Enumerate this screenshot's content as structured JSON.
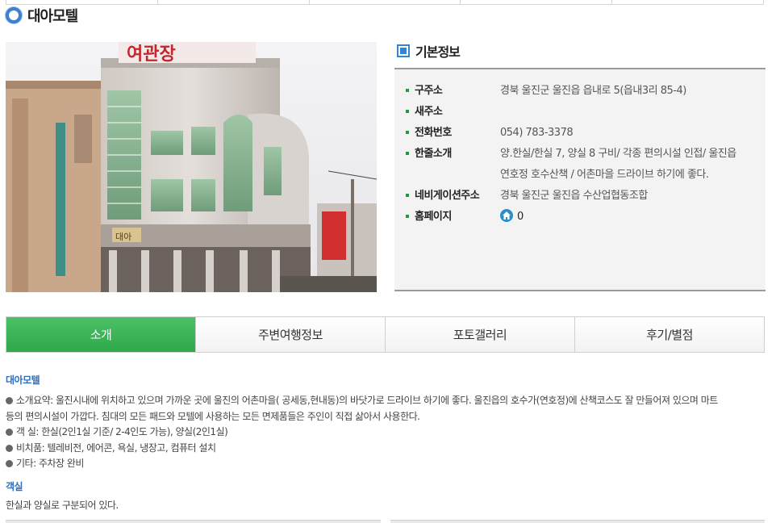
{
  "page": {
    "title": "대아모텔"
  },
  "photo": {
    "sign_text": "여관장",
    "shop_sign": "대아"
  },
  "basic_info": {
    "title": "기본정보",
    "rows": [
      {
        "label": "구주소",
        "value": "경북 울진군 울진읍 읍내로 5(읍내3리 85-4)"
      },
      {
        "label": "새주소",
        "value": ""
      },
      {
        "label": "전화번호",
        "value": "054) 783-3378"
      },
      {
        "label": "한줄소개",
        "value_line1": "양.한실/한실 7, 양실 8 구비/ 각종 편의시설 인접/ 울진읍",
        "value_line2": "연호정 호수산책 / 어촌마을 드라이브 하기에 좋다."
      },
      {
        "label": "네비게이션주소",
        "value": "경북 울진군 울진읍 수산업협동조합"
      },
      {
        "label": "홈페이지",
        "value": "0",
        "icon": "home-icon"
      }
    ]
  },
  "tabs": [
    {
      "label": "소개",
      "active": true
    },
    {
      "label": "주변여행정보",
      "active": false
    },
    {
      "label": "포토갤러리",
      "active": false
    },
    {
      "label": "후기/별점",
      "active": false
    }
  ],
  "description": {
    "section1_title": "대아모텔",
    "bullets": [
      "소개요약: 울진시내에 위치하고 있으며 가까운 곳에 울진의 어촌마을( 공세동,현내동)의 바닷가로 드라이브 하기에 좋다. 울진읍의 호수가(연호정)에 산책코스도 잘 만들어져 있으며 마트",
      "객 실: 한실(2인1실 기준/ 2-4인도 가능), 양실(2인1실)",
      "비치품: 텔레비전, 에어콘, 욕실, 냉장고, 컴퓨터 설치",
      "기타: 주차장 완비"
    ],
    "bullet1_cont": "등의 편의시설이 가깝다. 침대의 모든 패드와 모텔에 사용하는 모든 면제품들은 주인이 직접 삶아서 사용한다.",
    "section2_title": "객실",
    "section2_text": "한실과 양실로 구분되어 있다."
  },
  "colors": {
    "accent_green": "#2ea84b",
    "accent_blue": "#2d6ec0",
    "bullet_green": "#1f9a3f"
  }
}
